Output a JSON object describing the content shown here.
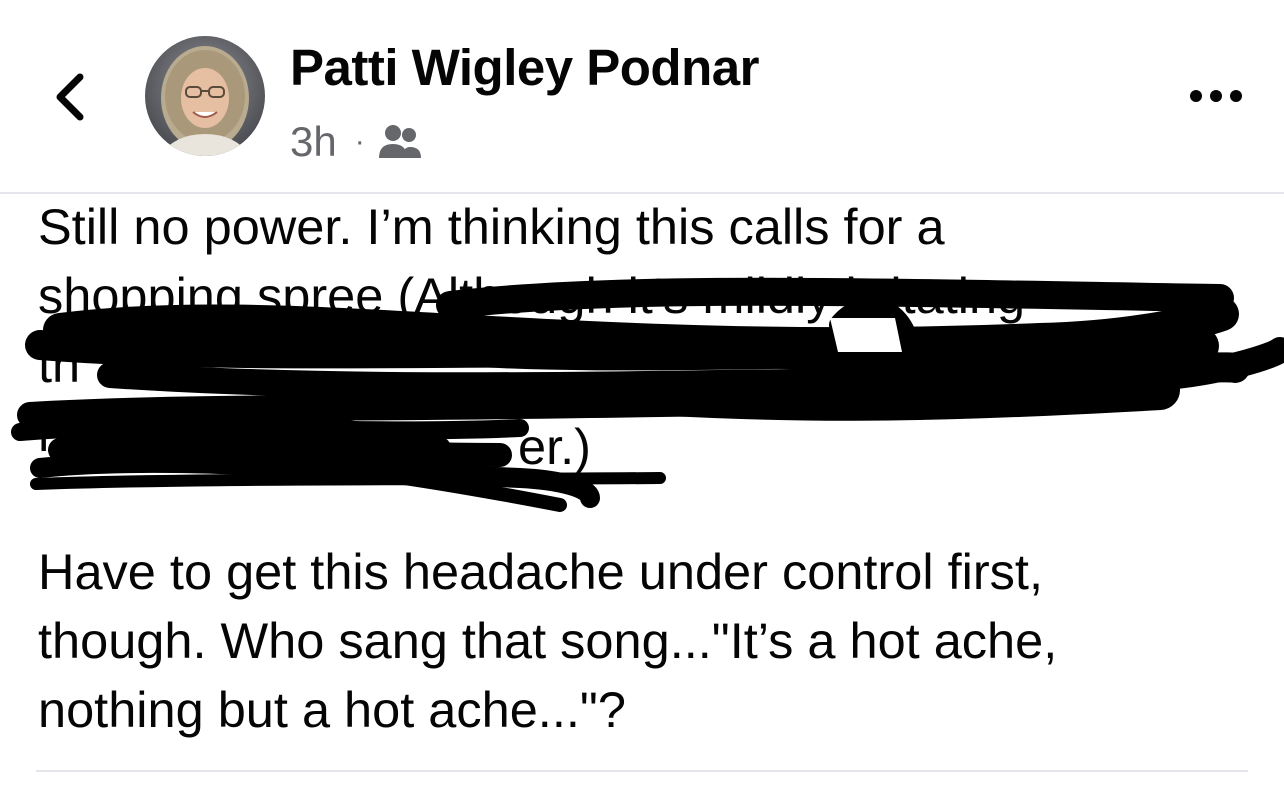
{
  "post": {
    "author_name": "Patti Wigley Podnar",
    "timestamp": "3h",
    "separator": "·",
    "audience_icon": "friends-icon",
    "text_lines_visible": [
      "Still no power. I’m thinking this calls for a",
      "shopping spree (Although it’s mildly irritating",
      "th",
      "my",
      "er.)"
    ],
    "second_paragraph": [
      "Have to get this headache under control first,",
      "though. Who sang that song...\"It’s a hot ache,",
      "nothing but a hot ache...\"?"
    ]
  },
  "icons": {
    "back": "chevron-left-icon",
    "more": "more-options-icon",
    "audience": "friends-icon"
  },
  "colors": {
    "text": "#050505",
    "secondary_text": "#65676b",
    "divider": "#e4e6eb",
    "redaction": "#000000"
  }
}
